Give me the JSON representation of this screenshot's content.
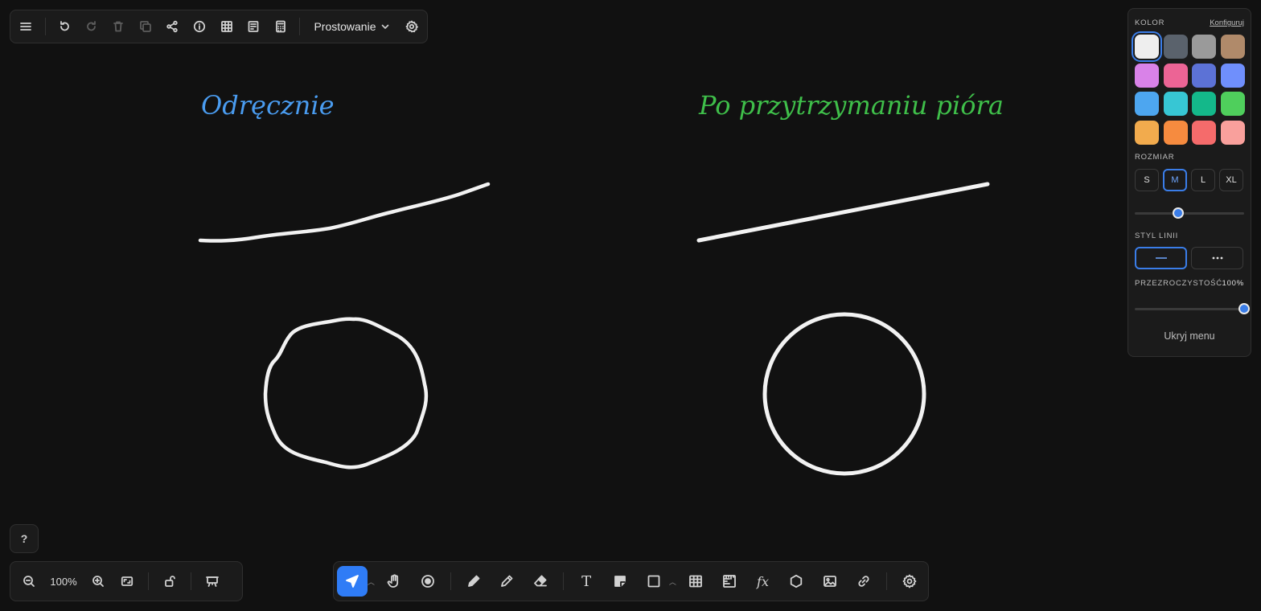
{
  "top_toolbar": {
    "icons": [
      "menu-icon",
      "undo-icon",
      "redo-icon",
      "trash-icon",
      "duplicate-icon",
      "share-icon",
      "info-icon",
      "table-icon",
      "notes-icon",
      "calculator-icon",
      "settings-icon"
    ],
    "mode_label": "Prostowanie"
  },
  "canvas": {
    "label_freehand": "Odręcznie",
    "label_hold": "Po przytrzymaniu pióra",
    "stroke_color": "#f2f2f2",
    "freehand_color": "#4a9cf0",
    "hold_color": "#3fbf4a"
  },
  "style_panel": {
    "color_title": "KOLOR",
    "customize": "Konfiguruj",
    "colors": [
      "#eeeeee",
      "#5a626c",
      "#9a9a9a",
      "#b08a6a",
      "#d982e8",
      "#ec6495",
      "#5c72d6",
      "#6f8ffc",
      "#4da6f0",
      "#37c6d4",
      "#14b88a",
      "#4fcf5c",
      "#f2ab4d",
      "#f68b3f",
      "#f56b6b",
      "#f9a09c"
    ],
    "selected_color": "#eeeeee",
    "size_title": "ROZMIAR",
    "sizes": [
      "S",
      "M",
      "L",
      "XL"
    ],
    "selected_size": "M",
    "size_level": 0.4,
    "line_title": "STYL LINII",
    "line_styles": [
      "solid",
      "dotted"
    ],
    "selected_line_style": "solid",
    "opacity_title": "PRZEZROCZYSTOŚĆ",
    "opacity_value": "100%",
    "opacity_level": 1.0,
    "hide_menu": "Ukryj menu"
  },
  "help": {
    "label": "?"
  },
  "zoom_bar": {
    "zoom_level": "100%",
    "icons": [
      "zoom-out-icon",
      "zoom-in-icon",
      "fit-screen-icon",
      "unlock-icon",
      "presentation-icon"
    ]
  },
  "tool_bar": {
    "active_tool": "select",
    "accent": "#2f7cf6",
    "text_tool_label": "T",
    "formula_tool_label": "fx",
    "tools": [
      "select",
      "hand",
      "laser",
      "pen",
      "pencil",
      "eraser",
      "text",
      "sticky-note",
      "shape",
      "table",
      "ruler",
      "formula",
      "polygon",
      "image",
      "link",
      "settings"
    ]
  }
}
